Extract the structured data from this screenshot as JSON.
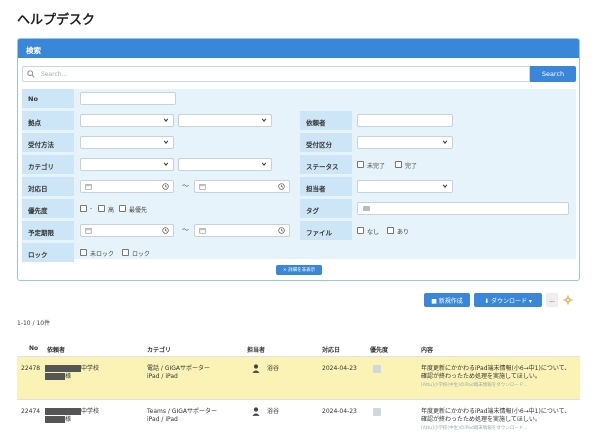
{
  "page": {
    "title": "ヘルプデスク"
  },
  "search": {
    "header": "検索",
    "placeholder": "Search...",
    "button": "Search",
    "detail_toggle": "× 詳細を非表示"
  },
  "form": {
    "no": "No",
    "kyoten": "拠点",
    "iraisha": "依頼者",
    "uketsuke_houhou": "受付方法",
    "uketsuke_kubun": "受付区分",
    "category": "カテゴリ",
    "status": "ステータス",
    "status_opt1": "未完了",
    "status_opt2": "完了",
    "taioubi": "対応日",
    "tantousha": "担当者",
    "yuusendo": "優先度",
    "prio_opt1": "-",
    "prio_opt2": "高",
    "prio_opt3": "最優先",
    "tag": "タグ",
    "yotei_kigen": "予定期限",
    "file": "ファイル",
    "file_opt1": "なし",
    "file_opt2": "あり",
    "lock": "ロック",
    "lock_opt1": "未ロック",
    "lock_opt2": "ロック",
    "tilde": "〜"
  },
  "toolbar": {
    "new": "新規作成",
    "download": "ダウンロード",
    "more": "..."
  },
  "results": {
    "count": "1-10 / 10件"
  },
  "table": {
    "headers": [
      "No",
      "依頼者",
      "カテゴリ",
      "担当者",
      "対応日",
      "優先度",
      "内容"
    ],
    "rows": [
      {
        "no": "22478",
        "requester_school": "中学校",
        "requester_suffix": "様",
        "category_line1": "電話 / GIGAサポーター",
        "category_line2": "iPad / iPad",
        "assignee": "浴谷",
        "date": "2024-04-23",
        "content": "年度更新にかかわるiPad端末情報(小6→中1)について、確認が終わったため処理を実施してほしい。",
        "content_sub": "[Attu]小学校(中生)のiPad端末情報をダウンロード..."
      },
      {
        "no": "22474",
        "requester_school": "中学校",
        "requester_suffix": "様",
        "category_line1": "Teams / GIGAサポーター",
        "category_line2": "iPad / iPad",
        "assignee": "浴谷",
        "date": "2024-04-23",
        "content": "年度更新にかかわるiPad端末情報(小6→中1)について、確認が終わったため処理を実施してほしい。",
        "content_sub": "[Attu]小学校(中生)のiPad端末情報をダウンロード..."
      }
    ]
  },
  "colors": {
    "accent": "#3a86d9",
    "label_bg": "#cde6f7",
    "form_bg": "#e6f3fb",
    "highlight_row": "#fbf3b6"
  },
  "icons": [
    "search-icon",
    "chevron-down-icon",
    "calendar-icon",
    "clock-icon",
    "tag-icon",
    "new-doc-icon",
    "download-icon",
    "gear-icon",
    "person-icon"
  ]
}
